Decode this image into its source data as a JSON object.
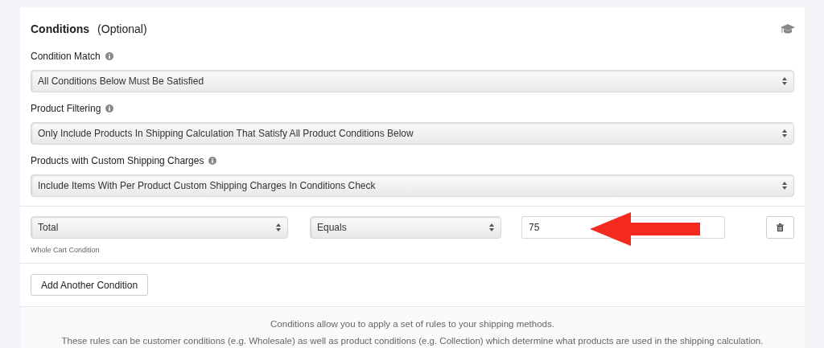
{
  "panel": {
    "title": "Conditions",
    "subtitle": "(Optional)"
  },
  "settings": [
    {
      "label": "Condition Match",
      "value": "All Conditions Below Must Be Satisfied"
    },
    {
      "label": "Product Filtering",
      "value": "Only Include Products In Shipping Calculation That Satisfy All Product Conditions Below"
    },
    {
      "label": "Products with Custom Shipping Charges",
      "value": "Include Items With Per Product Custom Shipping Charges In Conditions Check"
    }
  ],
  "conditions": [
    {
      "field": "Total",
      "operator": "Equals",
      "value": "75",
      "hint": "Whole Cart Condition"
    }
  ],
  "add_button": "Add Another Condition",
  "footer": [
    "Conditions allow you to apply a set of rules to your shipping methods.",
    "These rules can be customer conditions (e.g. Wholesale) as well as product conditions (e.g. Collection) which determine what products are used in the shipping calculation."
  ]
}
